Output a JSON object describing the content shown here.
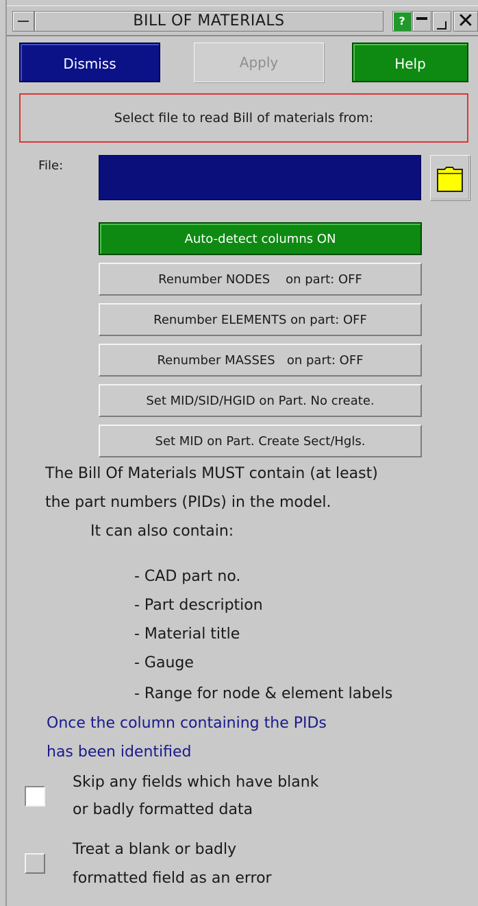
{
  "window": {
    "title": "BILL OF MATERIALS",
    "help_glyph": "?",
    "close_glyph": "✕"
  },
  "toolbar": {
    "dismiss_label": "Dismiss",
    "apply_label": "Apply",
    "help_label": "Help"
  },
  "prompt": "Select file to read Bill of materials from:",
  "file": {
    "label": "File:",
    "value": ""
  },
  "options": [
    {
      "label": "Auto-detect columns ON",
      "active": true
    },
    {
      "label": "Renumber NODES    on part: OFF",
      "active": false
    },
    {
      "label": "Renumber ELEMENTS on part: OFF",
      "active": false
    },
    {
      "label": "Renumber MASSES   on part: OFF",
      "active": false
    },
    {
      "label": "Set MID/SID/HGID on Part. No create.",
      "active": false
    },
    {
      "label": "Set MID on Part. Create Sect/Hgls.",
      "active": false
    }
  ],
  "info": {
    "line1": "The Bill Of Materials MUST contain (at least)",
    "line2": "the part numbers (PIDs) in the model.",
    "line3": "It can also contain:",
    "items": [
      "- CAD part no.",
      "- Part description",
      "- Material title",
      "- Gauge",
      "- Range for node & element labels"
    ],
    "note1": "Once the column containing the PIDs",
    "note2": "has been identified"
  },
  "checkboxes": [
    {
      "line1": "Skip any fields which have blank",
      "line2": "or badly formatted data",
      "checked": false
    },
    {
      "line1": "Treat a blank or badly",
      "line2": "formatted field as an error",
      "checked": false
    }
  ],
  "colors": {
    "dismiss": "#0b1288",
    "help": "#0e8a12",
    "file_field": "#0a0f7c",
    "folder": "#ffff00",
    "note_text": "#1a1a8c",
    "prompt_border": "#e03434"
  },
  "icons": {
    "folder": "folder-icon",
    "system_menu": "system-menu-icon",
    "minimize": "minimize-icon",
    "maximize": "maximize-icon",
    "close": "close-icon"
  }
}
